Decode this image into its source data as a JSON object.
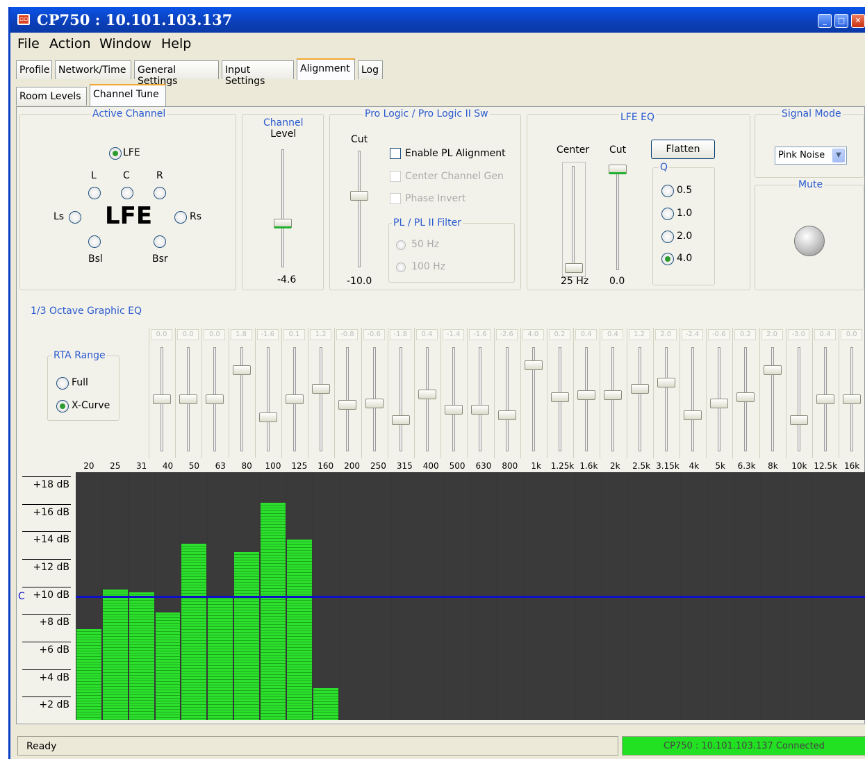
{
  "window": {
    "title": "CP750 : 10.101.103.137",
    "icon": "app-icon"
  },
  "menu": [
    "File",
    "Action",
    "Window",
    "Help"
  ],
  "tabs": [
    "Profile",
    "Network/Time",
    "General Settings",
    "Input Settings",
    "Alignment",
    "Log"
  ],
  "subtabs": [
    "Room Levels",
    "Channel Tune"
  ],
  "active_channel": {
    "caption": "Active Channel",
    "big_label": "LFE",
    "radios": {
      "lfe": "LFE",
      "l": "L",
      "c": "C",
      "r": "R",
      "ls": "Ls",
      "rs": "Rs",
      "bsl": "Bsl",
      "bsr": "Bsr"
    },
    "selected": "LFE"
  },
  "channel_level": {
    "caption1": "Channel",
    "caption2": "Level",
    "value": "-4.6"
  },
  "prologic": {
    "caption": "Pro Logic / Pro Logic II Sw",
    "cut_label": "Cut",
    "cut_value": "-10.0",
    "enable": "Enable PL Alignment",
    "center_gen": "Center Channel Gen",
    "phase": "Phase Invert",
    "filter_caption": "PL / PL II Filter",
    "f50": "50 Hz",
    "f100": "100 Hz"
  },
  "lfe_eq": {
    "caption": "LFE EQ",
    "center_label": "Center",
    "cut_label": "Cut",
    "flatten": "Flatten",
    "q_label": "Q",
    "q_options": [
      "0.5",
      "1.0",
      "2.0",
      "4.0"
    ],
    "q_selected": "4.0",
    "center_value": "25 Hz",
    "cut_value": "0.0"
  },
  "signal_mode": {
    "caption": "Signal Mode",
    "value": "Pink Noise"
  },
  "mute": {
    "caption": "Mute"
  },
  "graphic_eq": {
    "caption": "1/3 Octave Graphic EQ",
    "values": [
      "0.0",
      "0.0",
      "0.0",
      "1.8",
      "-1.6",
      "0.1",
      "1.2",
      "-0.8",
      "-0.6",
      "-1.8",
      "0.4",
      "-1.4",
      "-1.6",
      "-2.6",
      "4.0",
      "0.2",
      "0.4",
      "0.4",
      "1.2",
      "2.0",
      "-2.4",
      "-0.6",
      "0.2",
      "2.0",
      "-3.0",
      "0.4",
      "0.0"
    ],
    "slider_levels": [
      0.5,
      0.5,
      0.5,
      0.78,
      0.33,
      0.5,
      0.6,
      0.45,
      0.46,
      0.3,
      0.55,
      0.4,
      0.4,
      0.35,
      0.83,
      0.52,
      0.54,
      0.54,
      0.6,
      0.66,
      0.35,
      0.46,
      0.52,
      0.78,
      0.3,
      0.5,
      0.5
    ]
  },
  "rta_range": {
    "caption": "RTA Range",
    "full": "Full",
    "xcurve": "X-Curve",
    "selected": "X-Curve"
  },
  "chart_data": {
    "type": "bar",
    "categories": [
      "20",
      "25",
      "31",
      "40",
      "50",
      "63",
      "80",
      "100",
      "125",
      "160",
      "200",
      "250",
      "315",
      "400",
      "500",
      "630",
      "800",
      "1k",
      "1.25k",
      "1.6k",
      "2k",
      "2.5k",
      "3.15k",
      "4k",
      "5k",
      "6.3k",
      "8k",
      "10k",
      "12.5k",
      "16k"
    ],
    "values": [
      7.6,
      10.5,
      10.3,
      8.8,
      13.8,
      10,
      13.2,
      16.8,
      14.1,
      3.3,
      0,
      0,
      0,
      0,
      0,
      0,
      0,
      0,
      0,
      0,
      0,
      0,
      0,
      0,
      0,
      0,
      0,
      0,
      0,
      0
    ],
    "y_tick_labels": [
      "+18 dB",
      "+16 dB",
      "+14 dB",
      "+12 dB",
      "+10 dB",
      "+8 dB",
      "+6 dB",
      "+4 dB",
      "+2 dB"
    ],
    "y_ticks": [
      18,
      16,
      14,
      12,
      10,
      8,
      6,
      4,
      2
    ],
    "ylim": [
      1.0,
      19.0
    ],
    "reference_line": 10,
    "reference_marker": "C",
    "colors": {
      "fill": "#2ee02e",
      "background": "#383838",
      "line": "#1010c8"
    }
  },
  "status": {
    "left": "Ready",
    "right": "CP750 : 10.101.103.137 Connected"
  }
}
